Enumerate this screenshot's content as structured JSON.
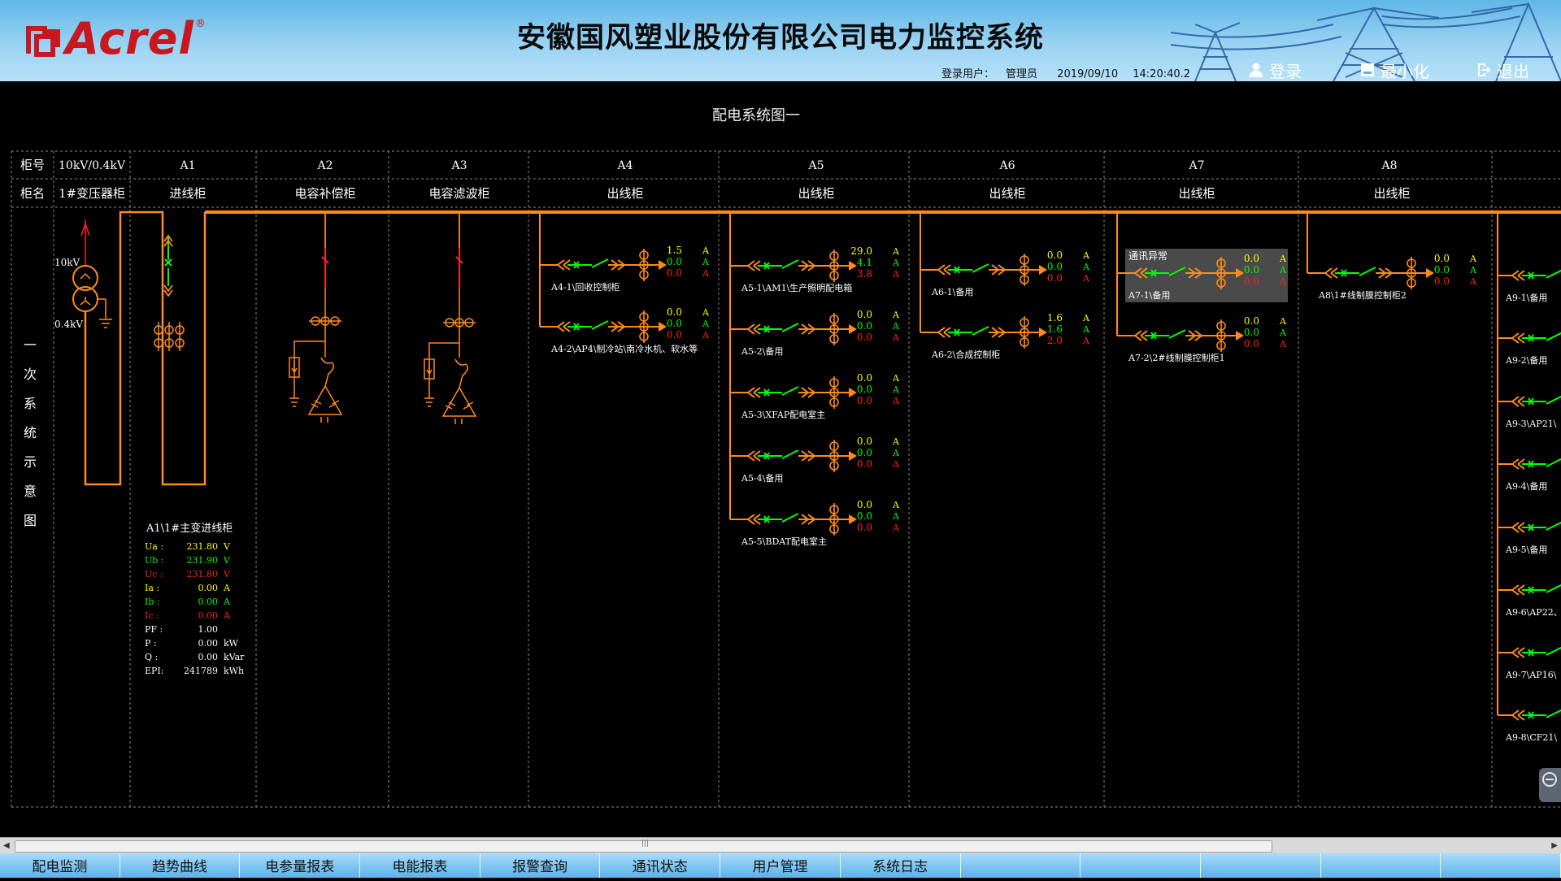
{
  "app": {
    "logo_text": "Acrel",
    "logo_reg": "®",
    "title": "安徽国风塑业股份有限公司电力监控系统"
  },
  "header": {
    "login_user_label": "登录用户：",
    "login_user": "管理员",
    "date": "2019/09/10",
    "time": "14:20:40.2",
    "buttons": {
      "login": "登录",
      "minimize": "最小化",
      "exit": "退出"
    }
  },
  "page": {
    "title": "配电系统图一"
  },
  "table": {
    "row1_label": "柜号",
    "row2_label": "柜名",
    "columns": [
      {
        "id": "10kV/0.4kV",
        "name": "1#变压器柜"
      },
      {
        "id": "A1",
        "name": "进线柜"
      },
      {
        "id": "A2",
        "name": "电容补偿柜"
      },
      {
        "id": "A3",
        "name": "电容滤波柜"
      },
      {
        "id": "A4",
        "name": "出线柜"
      },
      {
        "id": "A5",
        "name": "出线柜"
      },
      {
        "id": "A6",
        "name": "出线柜"
      },
      {
        "id": "A7",
        "name": "出线柜"
      },
      {
        "id": "A8",
        "name": "出线柜"
      }
    ],
    "side_label": [
      "一",
      "次",
      "系",
      "统",
      "示",
      "意",
      "图"
    ]
  },
  "transformer": {
    "hv": "10kV",
    "lv": "0.4kV"
  },
  "incoming": {
    "title": "A1\\1#主变进线柜",
    "rows": [
      {
        "label": "Ua :",
        "value": "231.80",
        "unit": "V",
        "color": "#ffff00"
      },
      {
        "label": "Ub :",
        "value": "231.90",
        "unit": "V",
        "color": "#00ff00"
      },
      {
        "label": "Uc :",
        "value": "231.80",
        "unit": "V",
        "color": "#ff2020"
      },
      {
        "label": "Ia :",
        "value": "0.00",
        "unit": "A",
        "color": "#ffff00"
      },
      {
        "label": "Ib :",
        "value": "0.00",
        "unit": "A",
        "color": "#00ff00"
      },
      {
        "label": "Ic :",
        "value": "0.00",
        "unit": "A",
        "color": "#ff2020"
      },
      {
        "label": "PF :",
        "value": "1.00",
        "unit": "",
        "color": "#ffffff"
      },
      {
        "label": "P  :",
        "value": "0.00",
        "unit": "kW",
        "color": "#ffffff"
      },
      {
        "label": "Q  :",
        "value": "0.00",
        "unit": "kVar",
        "color": "#ffffff"
      },
      {
        "label": "EPI:",
        "value": "241789",
        "unit": "kWh",
        "color": "#ffffff"
      }
    ]
  },
  "feeders": {
    "A4": [
      {
        "name": "A4-1\\回收控制柜",
        "ia": "1.5",
        "ib": "0.0",
        "ic": "0.0"
      },
      {
        "name": "A4-2\\AP4\\制冷站\\南冷水机、软水等",
        "ia": "0.0",
        "ib": "0.0",
        "ic": "0.0"
      }
    ],
    "A5": [
      {
        "name": "A5-1\\AM1\\生产照明配电箱",
        "ia": "29.0",
        "ib": "4.1",
        "ic": "3.8"
      },
      {
        "name": "A5-2\\备用",
        "ia": "0.0",
        "ib": "0.0",
        "ic": "0.0"
      },
      {
        "name": "A5-3\\XFAP配电室主",
        "ia": "0.0",
        "ib": "0.0",
        "ic": "0.0"
      },
      {
        "name": "A5-4\\备用",
        "ia": "0.0",
        "ib": "0.0",
        "ic": "0.0"
      },
      {
        "name": "A5-5\\BDAT配电室主",
        "ia": "0.0",
        "ib": "0.0",
        "ic": "0.0"
      }
    ],
    "A6": [
      {
        "name": "A6-1\\备用",
        "ia": "0.0",
        "ib": "0.0",
        "ic": "0.0"
      },
      {
        "name": "A6-2\\合成控制柜",
        "ia": "1.6",
        "ib": "1.6",
        "ic": "2.0"
      }
    ],
    "A7": [
      {
        "name": "A7-1\\备用",
        "ia": "0.0",
        "ib": "0.0",
        "ic": "0.0",
        "alarm": "通讯异常"
      },
      {
        "name": "A7-2\\2#线制膜控制柜1",
        "ia": "0.0",
        "ib": "0.0",
        "ic": "0.0"
      }
    ],
    "A8": [
      {
        "name": "A8\\1#线制膜控制柜2",
        "ia": "0.0",
        "ib": "0.0",
        "ic": "0.0"
      }
    ],
    "A9": [
      {
        "name": "A9-1\\备用"
      },
      {
        "name": "A9-2\\备用"
      },
      {
        "name": "A9-3\\AP21\\"
      },
      {
        "name": "A9-4\\备用"
      },
      {
        "name": "A9-5\\备用"
      },
      {
        "name": "A9-6\\AP22、"
      },
      {
        "name": "A9-7\\AP16\\"
      },
      {
        "name": "A9-8\\CF21\\"
      }
    ],
    "unit": "A"
  },
  "tabs": [
    "配电监测",
    "趋势曲线",
    "电参量报表",
    "电能报表",
    "报警查询",
    "通讯状态",
    "用户管理",
    "系统日志",
    "",
    "",
    "",
    "",
    ""
  ],
  "colors": {
    "bus": "#ff8c1a",
    "phase_a": "#ffff00",
    "phase_b": "#00ff00",
    "phase_c": "#ff2020",
    "breaker_closed": "#ff2020",
    "alarm_bg": "#4a4a4a",
    "header_bg": "#7cc6ee"
  }
}
